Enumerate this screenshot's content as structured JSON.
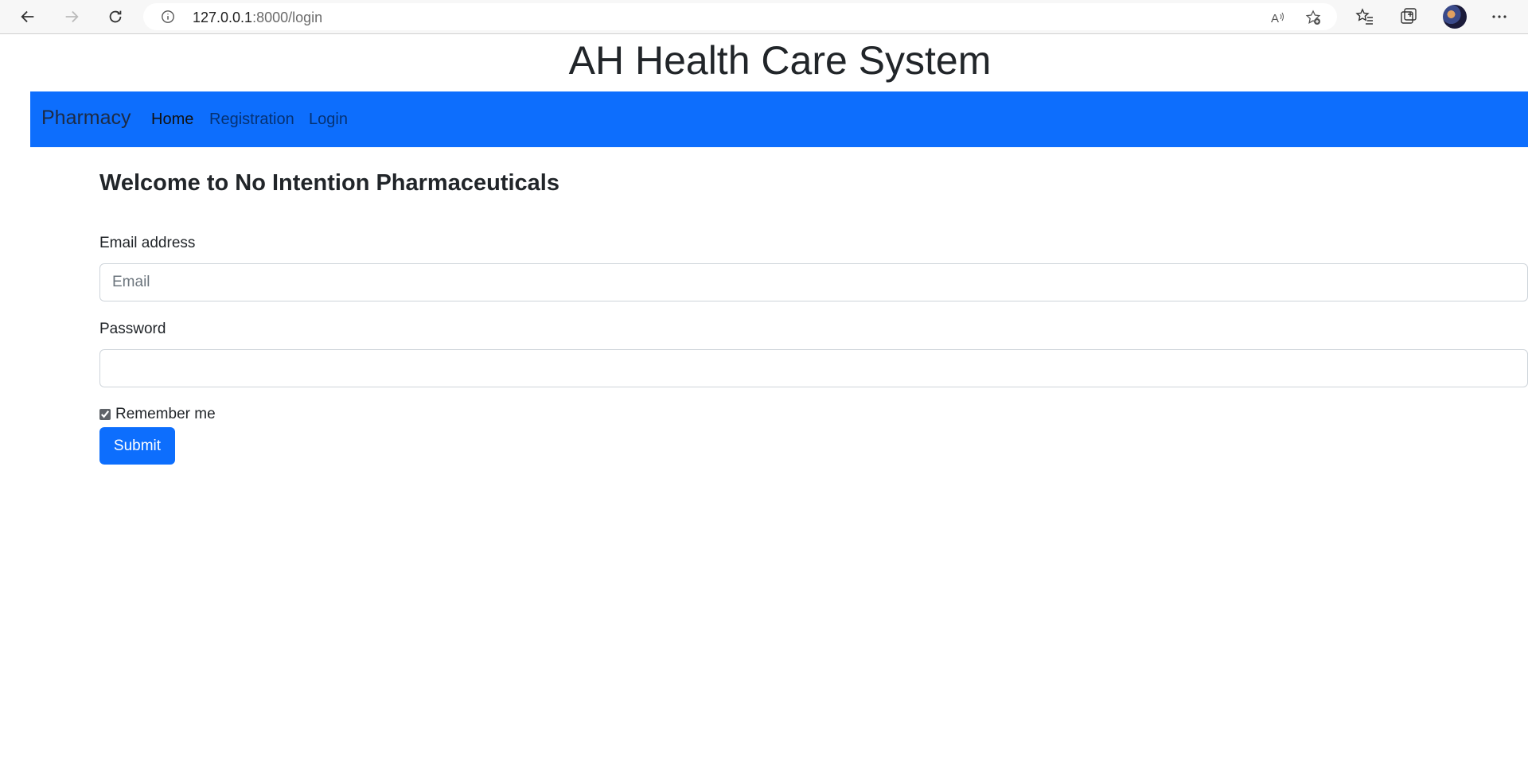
{
  "browser": {
    "url_host": "127.0.0.1",
    "url_rest": ":8000/login"
  },
  "page": {
    "site_title": "AH Health Care System",
    "navbar": {
      "brand": "Pharmacy",
      "links": [
        {
          "label": "Home",
          "active": true
        },
        {
          "label": "Registration",
          "active": false
        },
        {
          "label": "Login",
          "active": false
        }
      ]
    },
    "welcome_heading": "Welcome to No Intention Pharmaceuticals",
    "form": {
      "email_label": "Email address",
      "email_placeholder": "Email",
      "email_value": "",
      "password_label": "Password",
      "password_value": "",
      "remember_label": "Remember me",
      "remember_checked": true,
      "submit_label": "Submit"
    }
  },
  "colors": {
    "navbar_bg": "#0d6efd",
    "button_bg": "#0d6efd"
  }
}
